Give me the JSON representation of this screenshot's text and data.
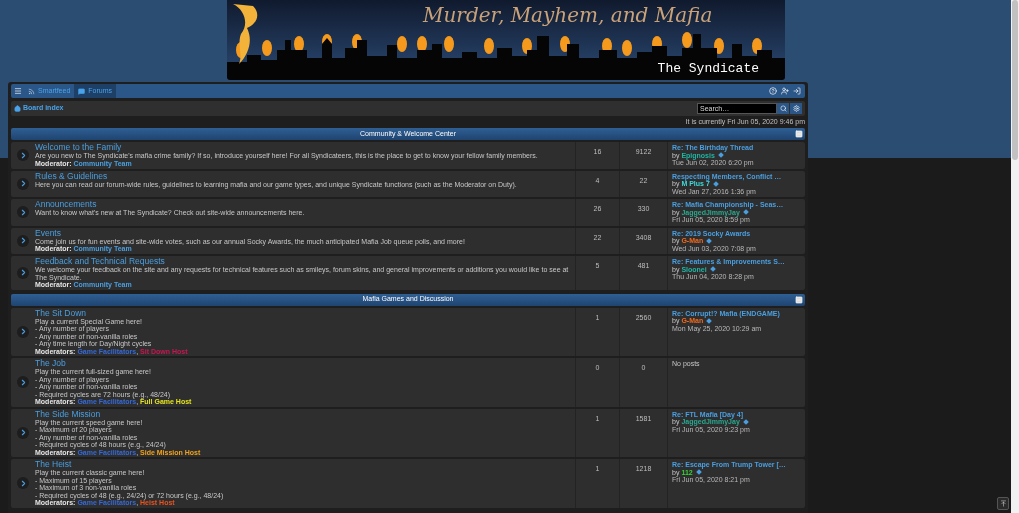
{
  "banner": {
    "title": "Murder, Mayhem, and Mafia",
    "subtitle": "The Syndicate"
  },
  "nav": {
    "tabs": [
      {
        "label": "Smartfeed",
        "selected": false
      },
      {
        "label": "Forums",
        "selected": true
      }
    ]
  },
  "breadcrumb": "Board index",
  "search": {
    "placeholder": "Search…"
  },
  "current_time": "It is currently Fri Jun 05, 2020 9:46 pm",
  "categories": [
    {
      "title": "Community & Welcome Center",
      "forums": [
        {
          "title": "Welcome to the Family",
          "lines": [
            "Are you new to The Syndicate's mafia crime family? If so, introduce yourself here! For all Syndicateers, this is the place to get to know your fellow family members."
          ],
          "moderator_label": "Moderator:",
          "moderators": [
            {
              "name": "Community Team",
              "color": "#4a9fe0"
            }
          ],
          "topics": "16",
          "posts": "9122",
          "last_post": {
            "title": "Re: The Birthday Thread",
            "by": "by",
            "author": "Epignosis",
            "color": "#1fb5a3",
            "date": "Tue Jun 02, 2020 6:20 pm"
          }
        },
        {
          "title": "Rules & Guidelines",
          "lines": [
            "Here you can read our forum-wide rules, guidelines to learning mafia and our game types, and unique Syndicate functions (such as the Moderator on Duty)."
          ],
          "topics": "4",
          "posts": "22",
          "last_post": {
            "title": "Respecting Members, Conflict …",
            "by": "by",
            "author": "M Plus 7",
            "color": "#3fd9d9",
            "date": "Wed Jan 27, 2016 1:36 pm"
          }
        },
        {
          "title": "Announcements",
          "lines": [
            "Want to know what's new at The Syndicate? Check out site-wide announcements here."
          ],
          "topics": "26",
          "posts": "330",
          "last_post": {
            "title": "Re: Mafia Championship - Seas…",
            "by": "by",
            "author": "JaggedJimmyJay",
            "color": "#2aa88e",
            "date": "Fri Jun 05, 2020 8:59 pm"
          }
        },
        {
          "title": "Events",
          "lines": [
            "Come join us for fun events and site-wide votes, such as our annual Socky Awards, the much anticipated Mafia Job queue polls, and more!"
          ],
          "moderator_label": "Moderator:",
          "moderators": [
            {
              "name": "Community Team",
              "color": "#4a9fe0"
            }
          ],
          "topics": "22",
          "posts": "3408",
          "last_post": {
            "title": "Re: 2019 Socky Awards",
            "by": "by",
            "author": "G-Man",
            "color": "#f06a1e",
            "date": "Wed Jun 03, 2020 7:08 pm"
          }
        },
        {
          "title": "Feedback and Technical Requests",
          "lines": [
            "We welcome your feedback on the site and any requests for technical features such as smileys, forum skins, and general improvements or additions you would like to see at The Syndicate."
          ],
          "moderator_label": "Moderator:",
          "moderators": [
            {
              "name": "Community Team",
              "color": "#4a9fe0"
            }
          ],
          "topics": "5",
          "posts": "481",
          "last_post": {
            "title": "Re: Features & Improvements S…",
            "by": "by",
            "author": "Sloonei",
            "color": "#1fb5a3",
            "date": "Thu Jun 04, 2020 8:28 pm"
          }
        }
      ]
    },
    {
      "title": "Mafia Games and Discussion",
      "forums": [
        {
          "title": "The Sit Down",
          "lines": [
            "Play a current Special Game here!",
            "- Any number of players",
            "- Any number of non-vanilla roles",
            "- Any time length for Day/Night cycles"
          ],
          "moderator_label": "Moderators:",
          "moderators": [
            {
              "name": "Game Facilitators",
              "color": "#3569d6",
              "separator": ","
            },
            {
              "name": "Sit Down Host",
              "color": "#c8174f"
            }
          ],
          "topics": "1",
          "posts": "2560",
          "last_post": {
            "title": "Re: Corrupt!? Mafia (ENDGAME)",
            "by": "by",
            "author": "G-Man",
            "color": "#f06a1e",
            "date": "Mon May 25, 2020 10:29 am"
          }
        },
        {
          "title": "The Job",
          "lines": [
            "Play the current full-sized game here!",
            "- Any number of players",
            "- Any number of non-vanilla roles",
            "- Required cycles are 72 hours (e.g., 48/24)"
          ],
          "moderator_label": "Moderators:",
          "moderators": [
            {
              "name": "Game Facilitators",
              "color": "#3569d6",
              "separator": ","
            },
            {
              "name": "Full Game Host",
              "color": "#e3e31c"
            }
          ],
          "topics": "0",
          "posts": "0",
          "no_posts": "No posts"
        },
        {
          "title": "The Side Mission",
          "lines": [
            "Play the current speed game here!",
            "- Maximum of 20 players",
            "- Any number of non-vanilla roles",
            "- Required cycles of 48 hours (e.g., 24/24)"
          ],
          "moderator_label": "Moderators:",
          "moderators": [
            {
              "name": "Game Facilitators",
              "color": "#3569d6",
              "separator": ","
            },
            {
              "name": "Side Mission Host",
              "color": "#f0a21c"
            }
          ],
          "topics": "1",
          "posts": "1581",
          "last_post": {
            "title": "Re: FTL Mafia [Day 4]",
            "by": "by",
            "author": "JaggedJimmyJay",
            "color": "#2aa88e",
            "date": "Fri Jun 05, 2020 9:23 pm"
          }
        },
        {
          "title": "The Heist",
          "lines": [
            "Play the current classic game here!",
            "- Maximum of 15 players",
            "- Maximum of 3 non-vanilla roles",
            "- Required cycles of 48 (e.g., 24/24) or 72 hours (e.g., 48/24)"
          ],
          "moderator_label": "Moderators:",
          "moderators": [
            {
              "name": "Game Facilitators",
              "color": "#3569d6",
              "separator": ","
            },
            {
              "name": "Heist Host",
              "color": "#e8531e"
            }
          ],
          "topics": "1",
          "posts": "1218",
          "last_post": {
            "title": "Re: Escape From Trump Tower […",
            "by": "by",
            "author": "112",
            "color": "#35d135",
            "date": "Fri Jun 05, 2020 8:21 pm"
          }
        }
      ]
    }
  ]
}
